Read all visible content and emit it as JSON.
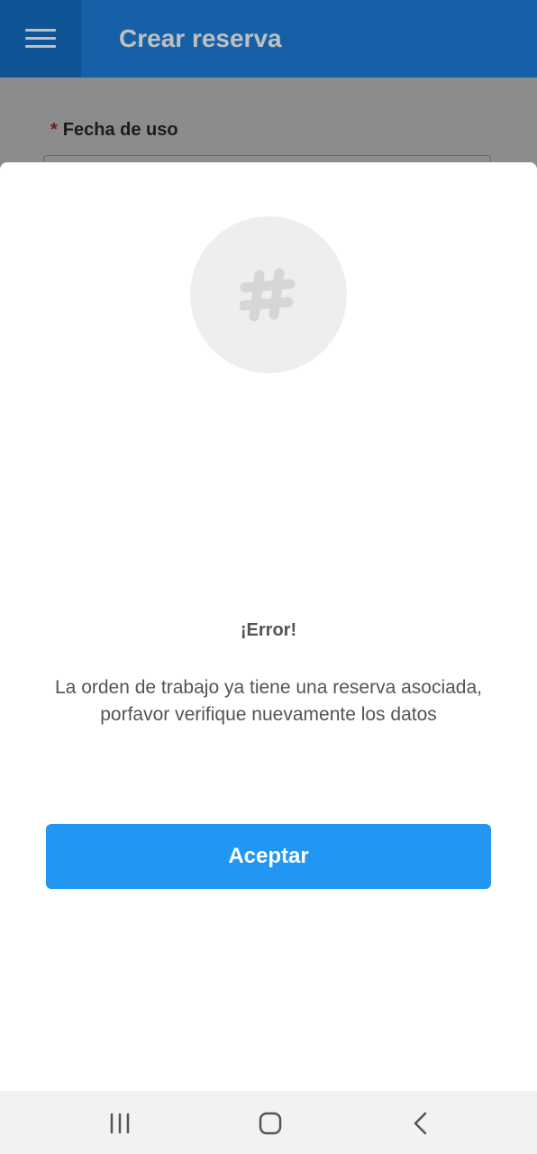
{
  "appbar": {
    "title": "Crear reserva",
    "menu_icon": "hamburger-menu-icon",
    "color": "#1c80de"
  },
  "form": {
    "fecha_label": "Fecha de uso",
    "required_mark": "*"
  },
  "modal": {
    "icon": "hashtag-icon",
    "title": "¡Error!",
    "message": "La orden de trabajo ya tiene una reserva asociada, porfavor verifique nuevamente los datos",
    "accept_label": "Aceptar",
    "accent": "#2196f3"
  },
  "system_nav": {
    "recent_icon": "recent-apps-icon",
    "home_icon": "home-icon",
    "back_icon": "back-icon"
  }
}
